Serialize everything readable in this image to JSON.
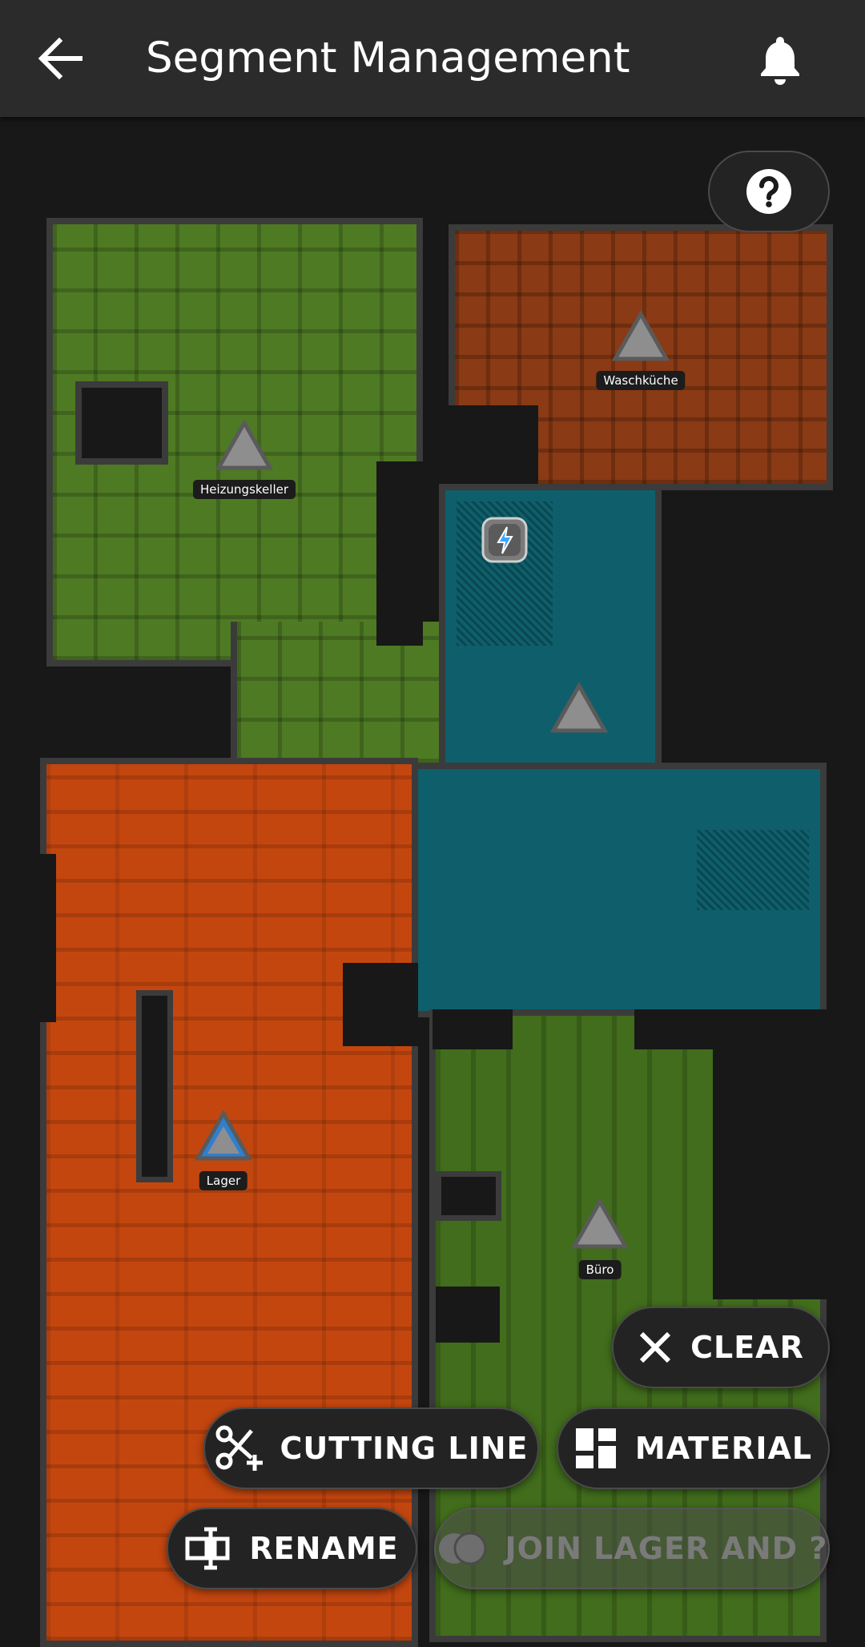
{
  "header": {
    "title": "Segment Management",
    "back_icon": "arrow-left-icon",
    "notification_icon": "bell-icon"
  },
  "help_button": {
    "icon": "help-circle-icon"
  },
  "map": {
    "colors": {
      "green": "#4e7a23",
      "dark_orange": "#8a3a14",
      "orange": "#c4460f",
      "teal": "#0e5f6b",
      "wall": "#3b3b3b",
      "selected_marker": "#2f7fd0"
    },
    "segments": [
      {
        "name": "Heizungskeller",
        "selected": false
      },
      {
        "name": "Waschküche",
        "selected": false
      },
      {
        "name": "",
        "selected": false
      },
      {
        "name": "Lager",
        "selected": true
      },
      {
        "name": "Büro",
        "selected": false
      }
    ],
    "dock_icon": "lightning-icon"
  },
  "actions": {
    "clear": "CLEAR",
    "cutting_line": "CUTTING LINE",
    "material": "MATERIAL",
    "rename": "RENAME",
    "join": "JOIN LAGER AND ?"
  }
}
